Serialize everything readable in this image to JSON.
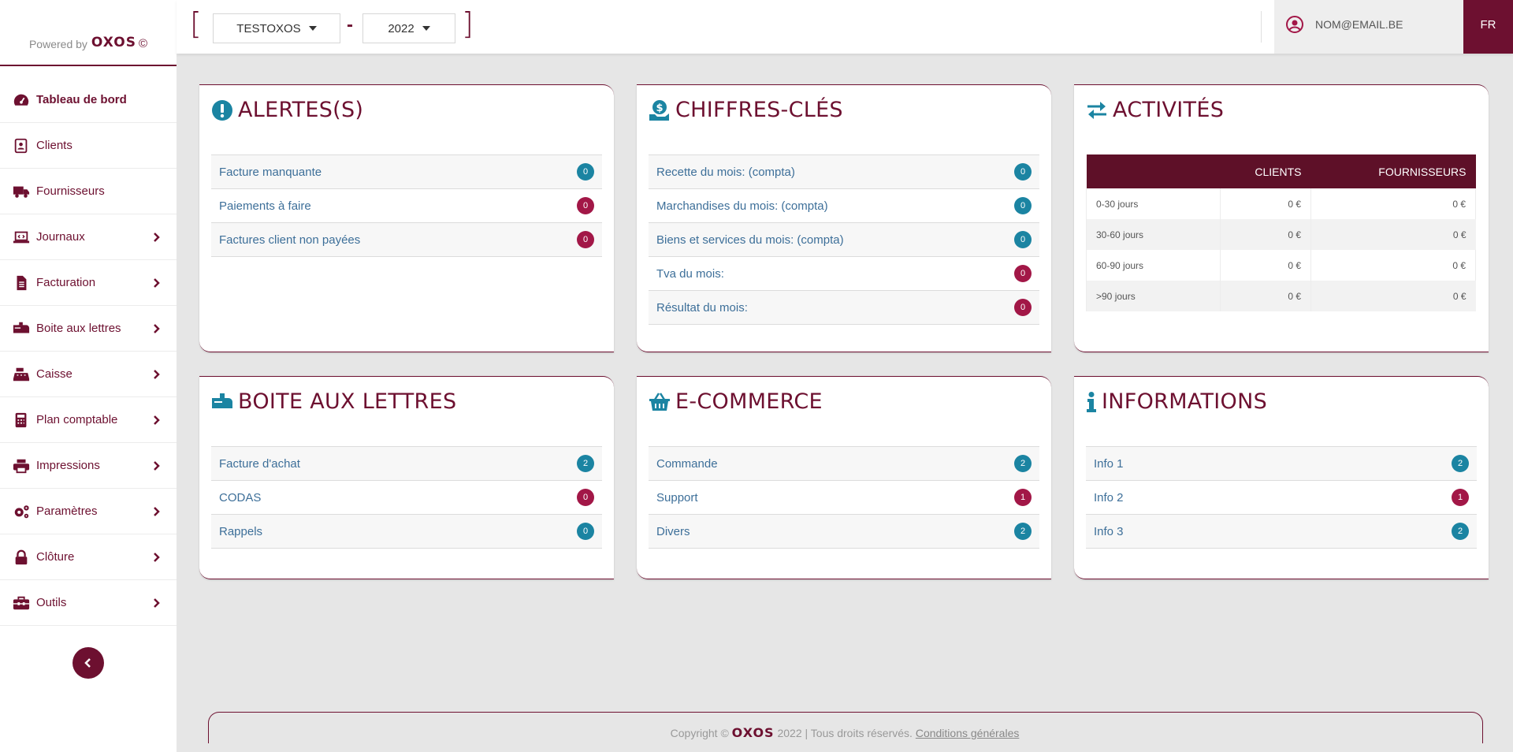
{
  "brand": {
    "powered_by": "Powered by",
    "logo": "OXOS",
    "copyright_symbol": "©"
  },
  "sidebar": {
    "items": [
      {
        "label": "Tableau de bord",
        "icon": "dashboard-icon",
        "active": true,
        "has_submenu": false
      },
      {
        "label": "Clients",
        "icon": "address-book-icon",
        "has_submenu": false
      },
      {
        "label": "Fournisseurs",
        "icon": "truck-icon",
        "has_submenu": false
      },
      {
        "label": "Journaux",
        "icon": "laptop-icon",
        "has_submenu": true
      },
      {
        "label": "Facturation",
        "icon": "file-invoice-icon",
        "has_submenu": true
      },
      {
        "label": "Boite aux lettres",
        "icon": "mailbox-icon",
        "has_submenu": true
      },
      {
        "label": "Caisse",
        "icon": "cash-register-icon",
        "has_submenu": true
      },
      {
        "label": "Plan comptable",
        "icon": "calculator-icon",
        "has_submenu": true
      },
      {
        "label": "Impressions",
        "icon": "printer-icon",
        "has_submenu": true
      },
      {
        "label": "Paramètres",
        "icon": "cogs-icon",
        "has_submenu": true
      },
      {
        "label": "Clôture",
        "icon": "lock-icon",
        "has_submenu": true
      },
      {
        "label": "Outils",
        "icon": "toolbox-icon",
        "has_submenu": true
      }
    ]
  },
  "topbar": {
    "bracket_open": "[",
    "bracket_close": "]",
    "company": "TESTOXOS",
    "separator": "-",
    "year": "2022",
    "user_email": "NOM@EMAIL.BE",
    "language": "FR"
  },
  "cards": {
    "alertes": {
      "title": "ALERTES(S)",
      "icon": "exclamation-circle-icon",
      "rows": [
        {
          "label": "Facture manquante",
          "count": "0",
          "color": "teal"
        },
        {
          "label": "Paiements à faire",
          "count": "0",
          "color": "red"
        },
        {
          "label": "Factures client non payées",
          "count": "0",
          "color": "red"
        }
      ]
    },
    "chiffres": {
      "title": "CHIFFRES-CLÉS",
      "icon": "money-hand-icon",
      "rows": [
        {
          "label": "Recette du mois: (compta)",
          "count": "0",
          "color": "teal"
        },
        {
          "label": "Marchandises du mois: (compta)",
          "count": "0",
          "color": "teal"
        },
        {
          "label": "Biens et services du mois: (compta)",
          "count": "0",
          "color": "teal"
        },
        {
          "label": "Tva du mois:",
          "count": "0",
          "color": "red"
        },
        {
          "label": "Résultat du mois:",
          "count": "0",
          "color": "red"
        }
      ]
    },
    "activites": {
      "title": "ACTIVITÉS",
      "icon": "exchange-arrows-icon",
      "headers": [
        "",
        "CLIENTS",
        "FOURNISSEURS"
      ],
      "rows": [
        {
          "period": "0-30 jours",
          "clients": "0 €",
          "fournisseurs": "0 €"
        },
        {
          "period": "30-60 jours",
          "clients": "0 €",
          "fournisseurs": "0 €"
        },
        {
          "period": "60-90 jours",
          "clients": "0 €",
          "fournisseurs": "0 €"
        },
        {
          "period": ">90 jours",
          "clients": "0 €",
          "fournisseurs": "0 €"
        }
      ]
    },
    "boite": {
      "title": "BOITE AUX LETTRES",
      "icon": "mailbox-icon",
      "rows": [
        {
          "label": "Facture d'achat",
          "count": "2",
          "color": "teal"
        },
        {
          "label": "CODAS",
          "count": "0",
          "color": "red"
        },
        {
          "label": "Rappels",
          "count": "0",
          "color": "teal"
        }
      ]
    },
    "ecommerce": {
      "title": "E-COMMERCE",
      "icon": "shopping-basket-icon",
      "rows": [
        {
          "label": "Commande",
          "count": "2",
          "color": "teal"
        },
        {
          "label": "Support",
          "count": "1",
          "color": "red"
        },
        {
          "label": "Divers",
          "count": "2",
          "color": "teal"
        }
      ]
    },
    "informations": {
      "title": "INFORMATIONS",
      "icon": "info-icon",
      "rows": [
        {
          "label": "Info 1",
          "count": "2",
          "color": "teal"
        },
        {
          "label": "Info 2",
          "count": "1",
          "color": "red"
        },
        {
          "label": "Info 3",
          "count": "2",
          "color": "teal"
        }
      ]
    }
  },
  "footer": {
    "copyright_prefix": "Copyright ©",
    "logo": "OXOS",
    "rights": "2022 | Tous droits réservés.",
    "terms_link": "Conditions générales"
  },
  "colors": {
    "brand": "#6d1030",
    "teal": "#1b84a2",
    "red": "#a21747",
    "link": "#3d6f99"
  }
}
